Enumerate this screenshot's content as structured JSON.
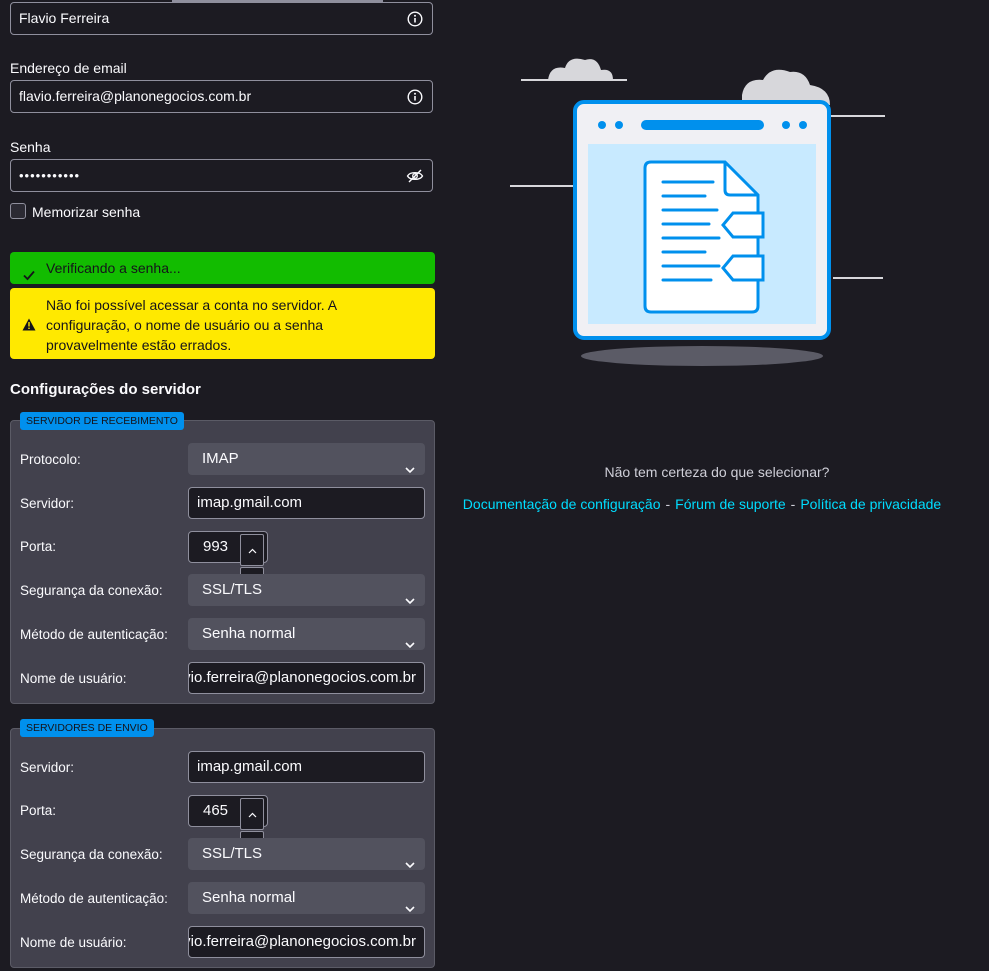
{
  "account": {
    "name_value": "Flavio Ferreira",
    "email_label": "Endereço de email",
    "email_value": "flavio.ferreira@planonegocios.com.br",
    "password_label": "Senha",
    "password_value": "•••••••••••",
    "remember_label": "Memorizar senha"
  },
  "notices": {
    "checking": "Verificando a senha...",
    "warning": "Não foi possível acessar a conta no servidor. A configuração, o nome de usuário ou a senha provavelmente estão errados."
  },
  "server_settings": {
    "title": "Configurações do servidor",
    "incoming": {
      "legend": "SERVIDOR DE RECEBIMENTO",
      "protocol_label": "Protocolo:",
      "protocol_value": "IMAP",
      "server_label": "Servidor:",
      "server_value": "imap.gmail.com",
      "port_label": "Porta:",
      "port_value": "993",
      "security_label": "Segurança da conexão:",
      "security_value": "SSL/TLS",
      "auth_label": "Método de autenticação:",
      "auth_value": "Senha normal",
      "username_label": "Nome de usuário:",
      "username_value": "flavio.ferreira@planonegocios.com.br"
    },
    "outgoing": {
      "legend": "SERVIDORES DE ENVIO",
      "server_label": "Servidor:",
      "server_value": "imap.gmail.com",
      "port_label": "Porta:",
      "port_value": "465",
      "security_label": "Segurança da conexão:",
      "security_value": "SSL/TLS",
      "auth_label": "Método de autenticação:",
      "auth_value": "Senha normal",
      "username_label": "Nome de usuário:",
      "username_value": "flavio.ferreira@planonegocios.com.br"
    }
  },
  "help": {
    "question": "Não tem certeza do que selecionar?",
    "links": [
      "Documentação de configuração",
      "Fórum de suporte",
      "Política de privacidade"
    ],
    "separator": "-"
  },
  "colors": {
    "background": "#1c1b22",
    "success": "#12bc00",
    "warning": "#ffe900",
    "accent": "#0090ed",
    "link": "#00ddff"
  },
  "icons": {
    "name_info": "info-icon",
    "email_info": "info-icon",
    "password_toggle": "eye-slash-icon",
    "checking": "checkmark-icon",
    "warning": "warning-icon",
    "dropdown": "chevron-down-icon",
    "illustration": "document-in-browser-illustration"
  }
}
